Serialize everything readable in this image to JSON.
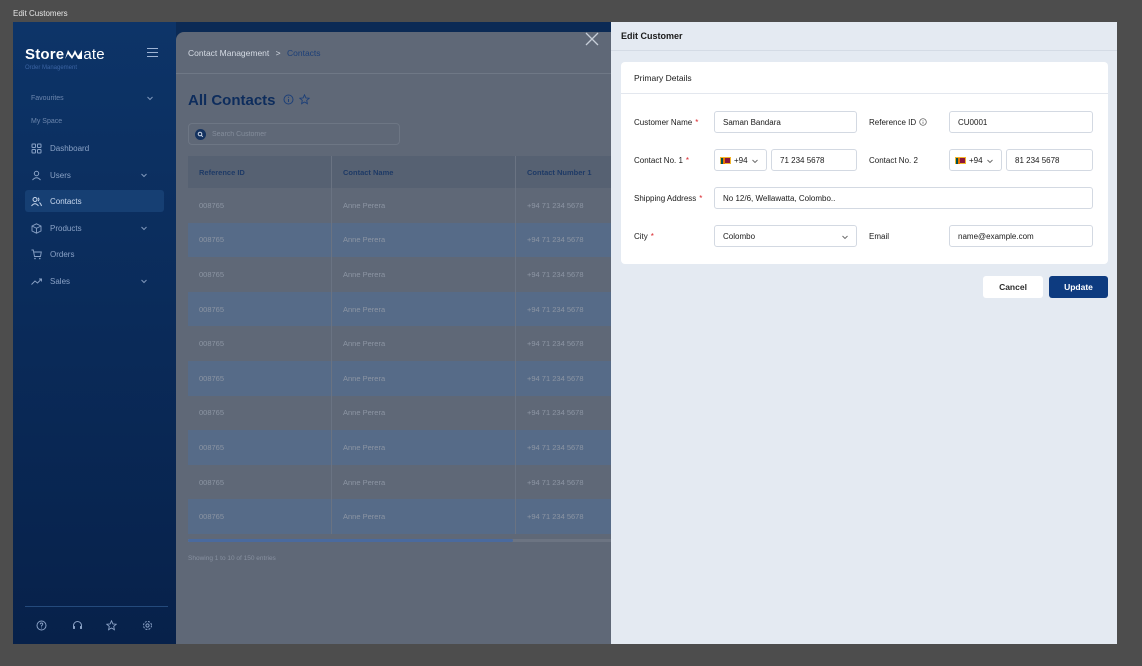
{
  "window": {
    "title": "Edit Customers"
  },
  "sidebar": {
    "logo_main": "Store",
    "logo_tail": "ate",
    "logo_sub": "Order Management",
    "sections": [
      {
        "label": "Favourites"
      },
      {
        "label": "My Space"
      }
    ],
    "items": [
      {
        "label": "Dashboard",
        "icon": "dashboard-icon"
      },
      {
        "label": "Users",
        "icon": "user-icon"
      },
      {
        "label": "Contacts",
        "icon": "contacts-icon",
        "active": true
      },
      {
        "label": "Products",
        "icon": "box-icon"
      },
      {
        "label": "Orders",
        "icon": "cart-icon"
      },
      {
        "label": "Sales",
        "icon": "trend-icon"
      }
    ],
    "footer_icons": [
      "help-icon",
      "headset-icon",
      "star-icon",
      "settings-icon"
    ]
  },
  "main": {
    "breadcrumb_parent": "Contact Management",
    "breadcrumb_sep": ">",
    "breadcrumb_current": "Contacts",
    "page_title": "All Contacts",
    "search_placeholder": "Search Customer",
    "columns": [
      "Reference ID",
      "Contact Name",
      "Contact Number 1"
    ],
    "rows": [
      [
        "008765",
        "Anne Perera",
        "+94 71 234 5678"
      ],
      [
        "008765",
        "Anne Perera",
        "+94 71 234 5678"
      ],
      [
        "008765",
        "Anne Perera",
        "+94 71 234 5678"
      ],
      [
        "008765",
        "Anne Perera",
        "+94 71 234 5678"
      ],
      [
        "008765",
        "Anne Perera",
        "+94 71 234 5678"
      ],
      [
        "008765",
        "Anne Perera",
        "+94 71 234 5678"
      ],
      [
        "008765",
        "Anne Perera",
        "+94 71 234 5678"
      ],
      [
        "008765",
        "Anne Perera",
        "+94 71 234 5678"
      ],
      [
        "008765",
        "Anne Perera",
        "+94 71 234 5678"
      ],
      [
        "008765",
        "Anne Perera",
        "+94 71 234 5678"
      ]
    ],
    "showing_text": "Showing 1 to 10 of 150 entries"
  },
  "drawer": {
    "title": "Edit Customer",
    "section_title": "Primary Details",
    "fields": {
      "customer_name": {
        "label": "Customer Name",
        "value": "Saman Bandara"
      },
      "reference_id": {
        "label": "Reference ID",
        "value": "CU0001"
      },
      "contact_no_1": {
        "label": "Contact No. 1",
        "code": "+94",
        "value": "71 234 5678"
      },
      "contact_no_2": {
        "label": "Contact No. 2",
        "code": "+94",
        "value": "81 234 5678"
      },
      "shipping_address": {
        "label": "Shipping Address",
        "value": "No 12/6, Wellawatta, Colombo.."
      },
      "city": {
        "label": "City",
        "value": "Colombo"
      },
      "email": {
        "label": "Email",
        "value": "name@example.com"
      }
    },
    "required_mark": "*",
    "cancel_label": "Cancel",
    "update_label": "Update"
  },
  "colors": {
    "sidebar_bg": "#0d3468",
    "primary": "#0d3b80",
    "drawer_bg": "#e4eaf2",
    "required": "#d9262c"
  }
}
